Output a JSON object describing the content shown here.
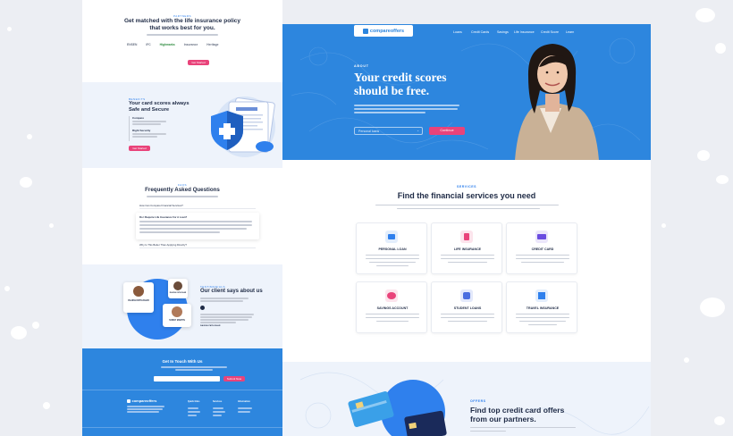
{
  "left": {
    "insurance": {
      "eyebrow": "PARTNERS",
      "title_line1": "Get matched with the life insurance policy",
      "title_line2": "that works best for you.",
      "logos": [
        "ENSEN",
        "IFC",
        "Highmarks",
        "Insurance",
        "Heritage"
      ],
      "button": "Get Started"
    },
    "cards": {
      "eyebrow": "BENEFITS",
      "title_line1": "Your card scores always",
      "title_line2": "Safe and Secure",
      "item1_title": "Compare",
      "item2_title": "Right Security",
      "button": "Get Started"
    },
    "faq": {
      "eyebrow": "FAQS",
      "title": "Frequently Asked Questions",
      "q1": "How Can Compare Financial Services?",
      "q2": "Do I Require Life Insurance For A Loan?",
      "q3": "How Do I Get Expert Advice On Debt Management?",
      "q4": "Why Is This Better Than Applying Directly?"
    },
    "testimonials": {
      "eyebrow": "TESTIMONIALS",
      "title": "Our client says about us",
      "person1": "RAJESH PATIL/DHAR",
      "person2": "RAJESH PATIL/DHAR",
      "person3": "SUNNY MARTIN",
      "author": "RAJESH PATIL/DHAR"
    },
    "contact": {
      "title": "Get In Touch With Us",
      "button": "Submit Now",
      "brand": "compareoffers",
      "col1": "Quick links",
      "col2": "Services",
      "col3": "Information"
    }
  },
  "right": {
    "nav": {
      "brand": "compareoffers",
      "links": [
        "Loans",
        "Credit Cards",
        "Savings",
        "Life Insurance",
        "Credit Score",
        "Learn"
      ]
    },
    "hero": {
      "eyebrow": "ABOUT",
      "title_line1": "Your credit scores",
      "title_line2": "should be free.",
      "input_placeholder": "Personal loans",
      "button": "Continue"
    },
    "services": {
      "eyebrow": "SERVICES",
      "title": "Find the financial services you need",
      "cards": [
        {
          "title": "PERSONAL LOAN",
          "color": "#2f80ed"
        },
        {
          "title": "LIFE INSURANCE",
          "color": "#e9437a"
        },
        {
          "title": "CREDIT CARD",
          "color": "#6a4ce0"
        },
        {
          "title": "SAVINGS ACCOUNT",
          "color": "#e9437a"
        },
        {
          "title": "STUDENT LOANS",
          "color": "#4a6ee0"
        },
        {
          "title": "TRAVEL INSURANCE",
          "color": "#2f80ed"
        }
      ]
    },
    "offers": {
      "eyebrow": "OFFERS",
      "title_line1": "Find top credit card offers",
      "title_line2": "from our partners."
    }
  },
  "colors": {
    "blue": "#2d86de",
    "navy": "#1f2b46",
    "pink": "#e9437a",
    "background": "#eceef3"
  }
}
